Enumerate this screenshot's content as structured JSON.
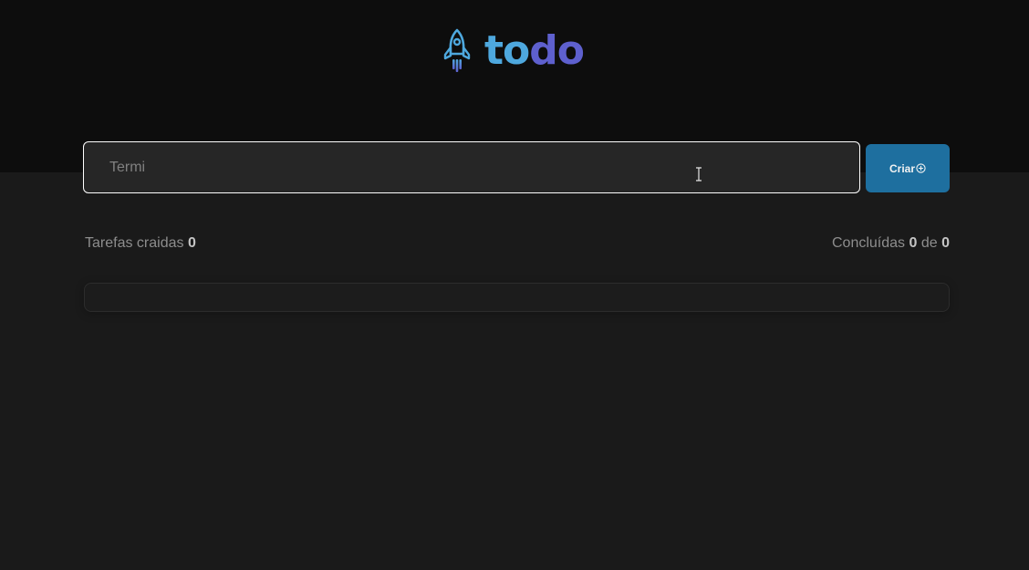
{
  "header": {
    "logo": {
      "icon": "rocket-icon",
      "text_part1": "to",
      "text_part2": "do",
      "color_part1": "#4ea8de",
      "color_part2": "#5e60ce"
    }
  },
  "new_task": {
    "input_value": "Termi",
    "create_button_label": "Criar",
    "create_button_icon": "plus-circle-icon",
    "accent_color": "#1e6f9f"
  },
  "stats": {
    "created_label": "Tarefas craidas",
    "created_count": "0",
    "completed_label": "Concluídas",
    "completed_count": "0",
    "completed_separator": "de",
    "total_count": "0"
  }
}
